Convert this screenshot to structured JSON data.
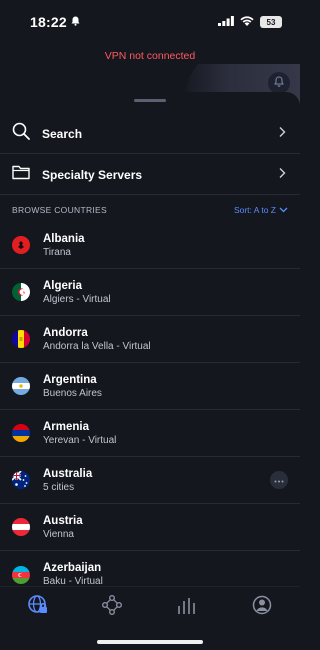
{
  "status_bar": {
    "time": "18:22",
    "battery": "53"
  },
  "vpn": {
    "status_text": "VPN not connected"
  },
  "menu": {
    "search_label": "Search",
    "specialty_label": "Specialty Servers"
  },
  "section": {
    "title": "BROWSE COUNTRIES",
    "sort_label": "Sort: A to Z"
  },
  "countries": [
    {
      "name": "Albania",
      "sub": "Tirana",
      "flag": "albania"
    },
    {
      "name": "Algeria",
      "sub": "Algiers - Virtual",
      "flag": "algeria"
    },
    {
      "name": "Andorra",
      "sub": "Andorra la Vella - Virtual",
      "flag": "andorra"
    },
    {
      "name": "Argentina",
      "sub": "Buenos Aires",
      "flag": "argentina"
    },
    {
      "name": "Armenia",
      "sub": "Yerevan - Virtual",
      "flag": "armenia"
    },
    {
      "name": "Australia",
      "sub": "5 cities",
      "flag": "australia",
      "has_more": true
    },
    {
      "name": "Austria",
      "sub": "Vienna",
      "flag": "austria"
    },
    {
      "name": "Azerbaijan",
      "sub": "Baku - Virtual",
      "flag": "azerbaijan"
    }
  ],
  "tabs": [
    {
      "icon": "globe-lock-icon",
      "active": true
    },
    {
      "icon": "network-nodes-icon",
      "active": false
    },
    {
      "icon": "stats-bars-icon",
      "active": false
    },
    {
      "icon": "profile-icon",
      "active": false
    }
  ],
  "colors": {
    "background": "#15171f",
    "accent": "#5a8cff",
    "error": "#ff5a5f",
    "divider": "#262a36"
  }
}
